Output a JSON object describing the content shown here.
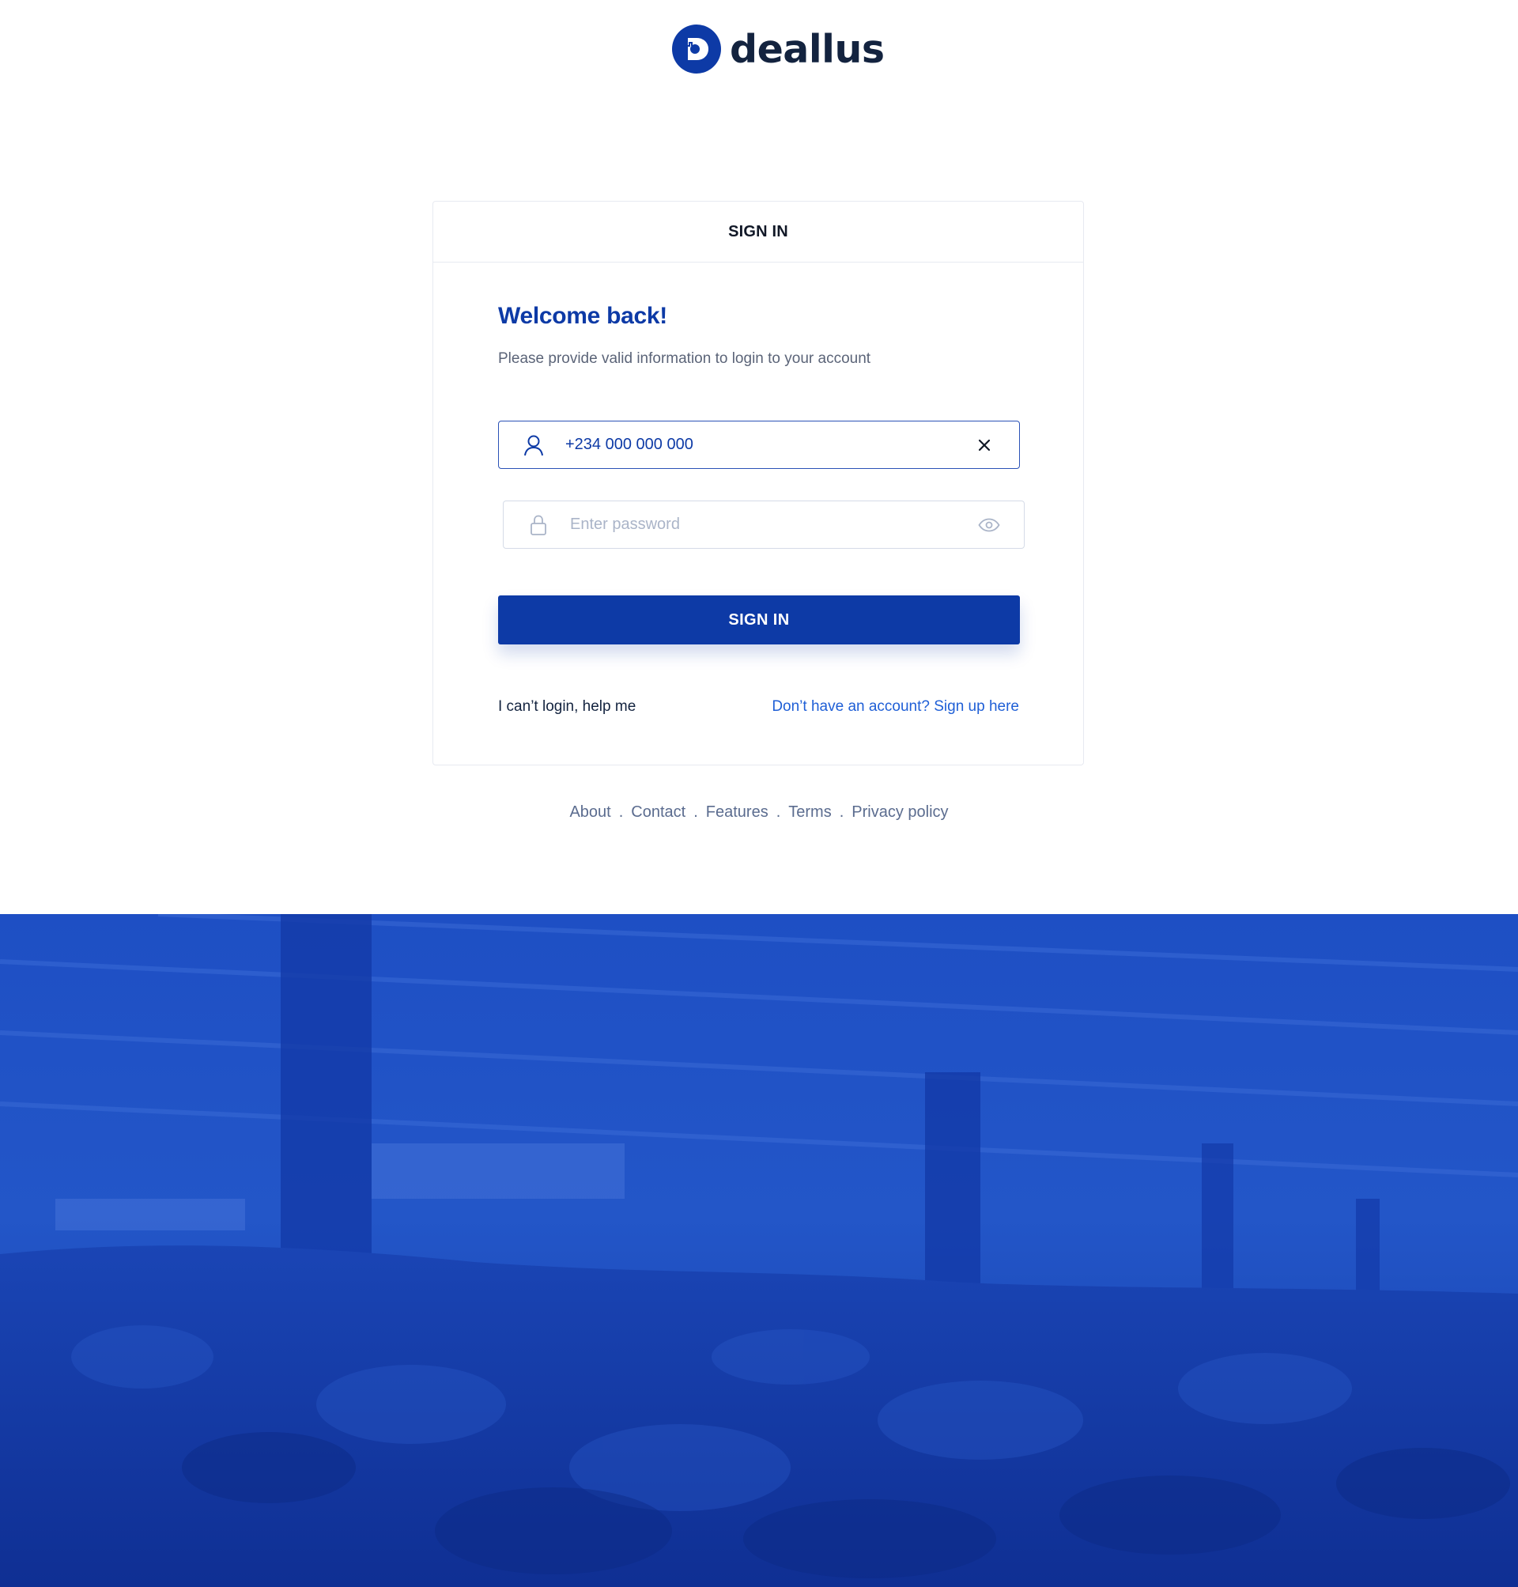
{
  "brand": {
    "name": "deallus",
    "logo_icon": "deallus-logo-icon",
    "primary_color": "#0d3aa6"
  },
  "card": {
    "header_title": "SIGN IN",
    "welcome_title": "Welcome back!",
    "subtitle": "Please provide valid information to login to your account"
  },
  "phone_field": {
    "value": "+234 000 000 000",
    "lead_icon": "user-icon",
    "trail_icon": "clear-icon"
  },
  "password_field": {
    "value": "",
    "placeholder": "Enter password",
    "lead_icon": "lock-icon",
    "trail_icon": "eye-icon"
  },
  "sign_in_button": {
    "label": "SIGN IN"
  },
  "links": {
    "help": "I can’t login, help me",
    "signup": "Don’t have an account? Sign up here"
  },
  "footer": {
    "items": [
      "About",
      "Contact",
      "Features",
      "Terms",
      "Privacy policy"
    ],
    "separator": "."
  },
  "hero": {
    "tint_color": "#1c4cc0"
  }
}
